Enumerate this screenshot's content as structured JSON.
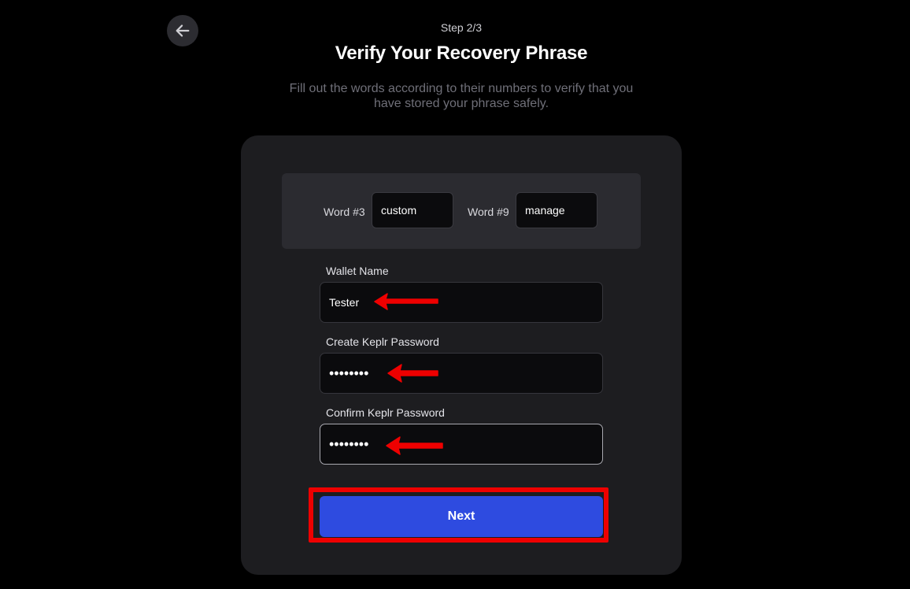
{
  "header": {
    "step": "Step 2/3",
    "title": "Verify Your Recovery Phrase",
    "subtitle": "Fill out the words according to their numbers to verify that you have stored your phrase safely."
  },
  "icons": {
    "back": "arrow-left-icon",
    "annotation": "red-arrow-icon"
  },
  "words": [
    {
      "label": "Word #3",
      "value": "custom"
    },
    {
      "label": "Word #9",
      "value": "manage"
    }
  ],
  "form": {
    "wallet_name": {
      "label": "Wallet Name",
      "value": "Tester"
    },
    "password": {
      "label": "Create Keplr Password",
      "value": "••••••••"
    },
    "confirm_password": {
      "label": "Confirm Keplr Password",
      "value": "••••••••"
    }
  },
  "next_label": "Next",
  "colors": {
    "background": "#000000",
    "card": "#1d1d20",
    "accent": "#2e4be0",
    "highlight": "#ee0000"
  }
}
